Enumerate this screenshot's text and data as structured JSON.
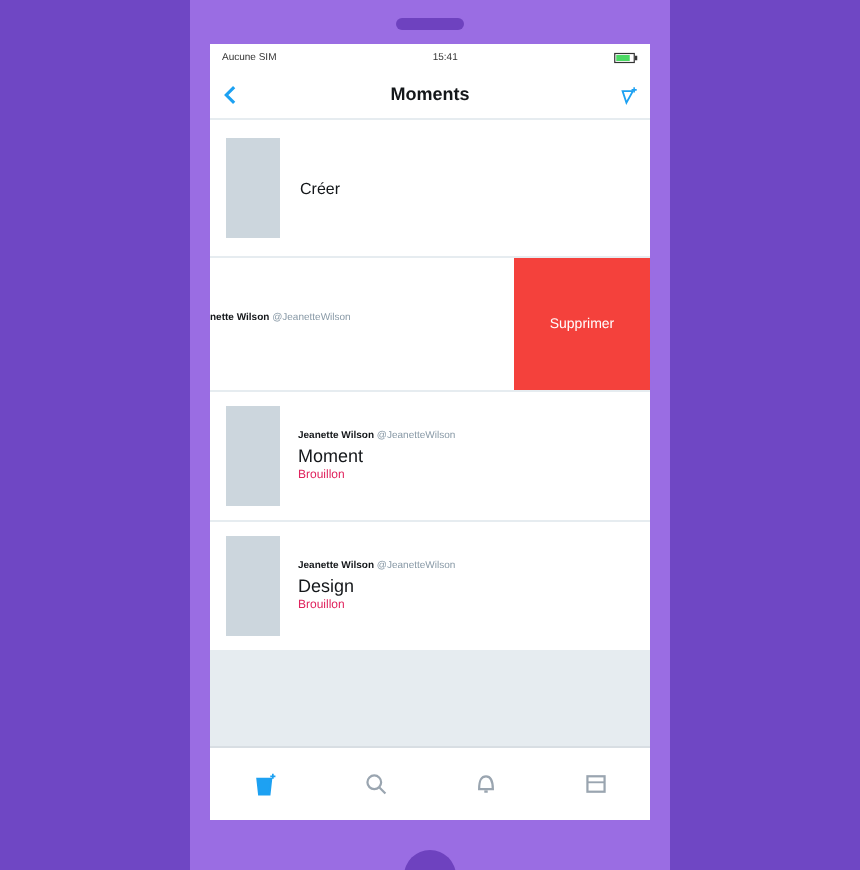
{
  "status_bar": {
    "carrier": "Aucune SIM",
    "time": "15:41"
  },
  "nav": {
    "title": "Moments"
  },
  "create_row": {
    "label": "Créer"
  },
  "swiped_row": {
    "author": "nette Wilson",
    "handle": "@JeanetteWilson",
    "delete_label": "Supprimer"
  },
  "moments": [
    {
      "author": "Jeanette Wilson",
      "handle": "@JeanetteWilson",
      "title": "Moment",
      "status": "Brouillon"
    },
    {
      "author": "Jeanette Wilson",
      "handle": "@JeanetteWilson",
      "title": "Design",
      "status": "Brouillon"
    }
  ],
  "tabs": [
    {
      "kind": "moments",
      "selected": true
    },
    {
      "kind": "search",
      "selected": false
    },
    {
      "kind": "notifications",
      "selected": false
    },
    {
      "kind": "messages",
      "selected": false
    }
  ]
}
